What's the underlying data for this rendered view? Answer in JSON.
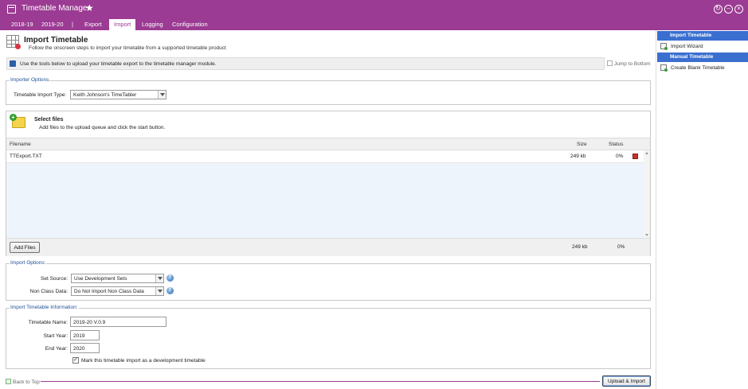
{
  "app": {
    "title": "Timetable Manager"
  },
  "menu": [
    "2018-19",
    "2019-20",
    "|",
    "Export",
    "Import",
    "Logging",
    "Configuration"
  ],
  "menu_active": "Import",
  "header": {
    "title": "Import Timetable",
    "subtitle": "Follow the onscreen steps to import your timetable from a supported timetable product"
  },
  "infobar": {
    "text": "Use the tools below to upload your timetable export to the timetable manager module.",
    "jump_label": "Jump to Bottom"
  },
  "importer_options": {
    "legend": "Importer Options",
    "type_label": "Timetable Import Type:",
    "type_value": "Keith Johnson's TimeTabler"
  },
  "upload": {
    "title": "Select files",
    "subtitle": "Add files to the upload queue and click the start button.",
    "col_filename": "Filename",
    "col_size": "Size",
    "col_status": "Status",
    "files": [
      {
        "name": "TTExport.TXT",
        "size": "249 kb",
        "status": "0%"
      }
    ],
    "add_files_label": "Add Files",
    "total_size": "249 kb",
    "total_status": "0%"
  },
  "import_options": {
    "legend": "Import Options:",
    "set_source_label": "Set Source:",
    "set_source_value": "Use Development Sets",
    "non_class_label": "Non Class Data:",
    "non_class_value": "Do Not Import Non Class Data"
  },
  "timetable_info": {
    "legend": "Import Timetable Information:",
    "name_label": "Timetable Name:",
    "name_value": "2019-20 V.0.9",
    "start_label": "Start Year:",
    "start_value": "2019",
    "end_label": "End Year:",
    "end_value": "2020",
    "dev_checkbox_label": "Mark this timetable import as a development timetable",
    "dev_checked": true
  },
  "footer": {
    "back_to_top": "Back to Top",
    "upload_import": "Upload & Import"
  },
  "sidebar": {
    "section1": "Import Timetable",
    "item1": "Import Wizard",
    "section2": "Manual Timetable",
    "item2": "Create Blank Timetable"
  },
  "colors": {
    "brand": "#9b3b93",
    "sidebar_header": "#3a6fd0",
    "legend": "#1f4f96"
  }
}
